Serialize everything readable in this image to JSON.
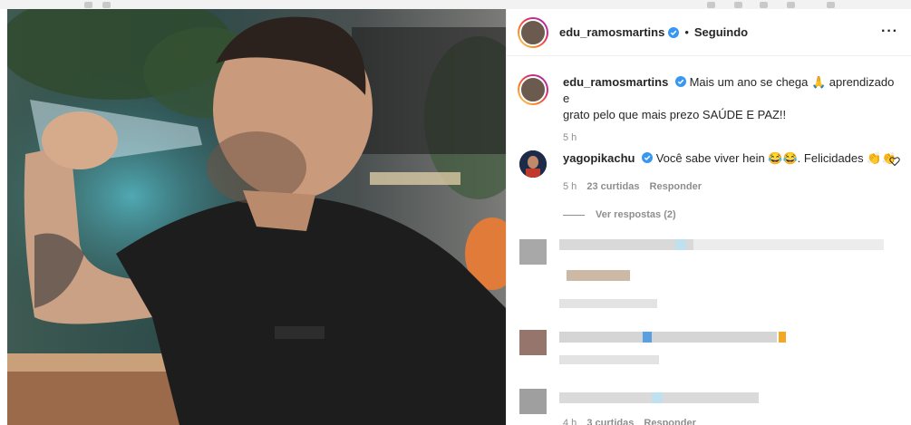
{
  "post": {
    "author": "edu_ramosmartins",
    "separator": "•",
    "follow_status": "Seguindo",
    "more_icon": "···",
    "caption_author": "edu_ramosmartins",
    "caption_line1": "Mais um ano se chega 🙏 aprendizado e",
    "caption_line2": "grato pelo que mais prezo SAÚDE E PAZ!!",
    "caption_time": "5 h"
  },
  "comments": [
    {
      "author": "yagopikachu",
      "text": "Você sabe viver hein 😂😂. Felicidades 👏👏",
      "time": "5 h",
      "likes": "23 curtidas",
      "reply": "Responder",
      "view_replies": "Ver respostas (2)"
    }
  ],
  "last_meta": {
    "time": "4 h",
    "likes": "3 curtidas",
    "reply": "Responder"
  },
  "colors": {
    "verified": "#3897f0",
    "text": "#262626",
    "muted": "#8e8e8e"
  }
}
